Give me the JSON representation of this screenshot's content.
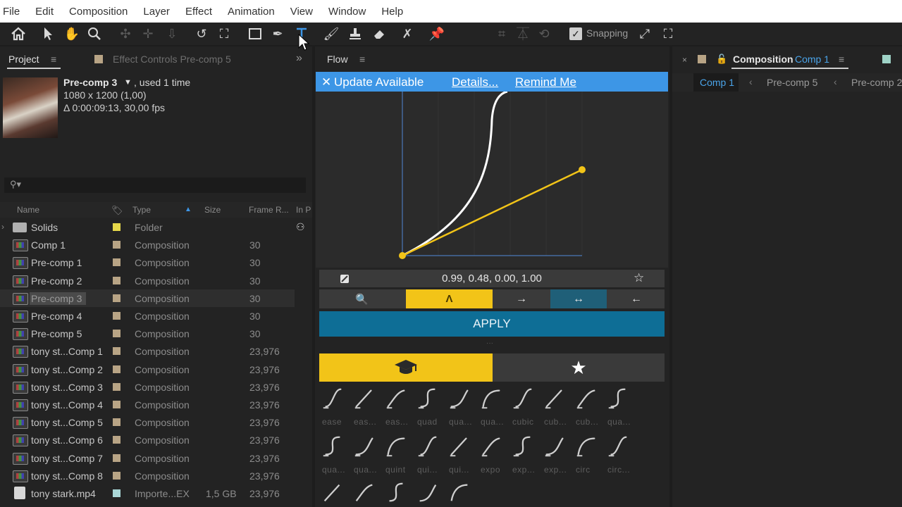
{
  "menu": [
    "File",
    "Edit",
    "Composition",
    "Layer",
    "Effect",
    "Animation",
    "View",
    "Window",
    "Help"
  ],
  "toolbar": {
    "snapping_label": "Snapping"
  },
  "project_panel": {
    "tab_label": "Project",
    "effect_controls_label": "Effect Controls Pre-comp 5",
    "selected_name": "Pre-comp 3",
    "used_info": ", used 1 time",
    "dimensions": "1080 x 1200 (1,00)",
    "duration": "Δ 0:00:09:13, 30,00 fps",
    "columns": [
      "Name",
      "Type",
      "Size",
      "Frame R...",
      "In P"
    ],
    "rows": [
      {
        "name": "Solids",
        "type": "Folder",
        "size": "",
        "fps": "",
        "kind": "folder"
      },
      {
        "name": "Comp 1",
        "type": "Composition",
        "size": "",
        "fps": "30",
        "kind": "comp"
      },
      {
        "name": "Pre-comp 1",
        "type": "Composition",
        "size": "",
        "fps": "30",
        "kind": "comp"
      },
      {
        "name": "Pre-comp 2",
        "type": "Composition",
        "size": "",
        "fps": "30",
        "kind": "comp"
      },
      {
        "name": "Pre-comp 3",
        "type": "Composition",
        "size": "",
        "fps": "30",
        "kind": "comp",
        "selected": true
      },
      {
        "name": "Pre-comp 4",
        "type": "Composition",
        "size": "",
        "fps": "30",
        "kind": "comp"
      },
      {
        "name": "Pre-comp 5",
        "type": "Composition",
        "size": "",
        "fps": "30",
        "kind": "comp"
      },
      {
        "name": "tony st...Comp 1",
        "type": "Composition",
        "size": "",
        "fps": "23,976",
        "kind": "comp"
      },
      {
        "name": "tony st...Comp 2",
        "type": "Composition",
        "size": "",
        "fps": "23,976",
        "kind": "comp"
      },
      {
        "name": "tony st...Comp 3",
        "type": "Composition",
        "size": "",
        "fps": "23,976",
        "kind": "comp"
      },
      {
        "name": "tony st...Comp 4",
        "type": "Composition",
        "size": "",
        "fps": "23,976",
        "kind": "comp"
      },
      {
        "name": "tony st...Comp 5",
        "type": "Composition",
        "size": "",
        "fps": "23,976",
        "kind": "comp"
      },
      {
        "name": "tony st...Comp 6",
        "type": "Composition",
        "size": "",
        "fps": "23,976",
        "kind": "comp"
      },
      {
        "name": "tony st...Comp 7",
        "type": "Composition",
        "size": "",
        "fps": "23,976",
        "kind": "comp"
      },
      {
        "name": "tony st...Comp 8",
        "type": "Composition",
        "size": "",
        "fps": "23,976",
        "kind": "comp"
      },
      {
        "name": "tony stark.mp4",
        "type": "Importe...EX",
        "size": "1,5 GB",
        "fps": "23,976",
        "kind": "footage"
      }
    ]
  },
  "flow_panel": {
    "tab_label": "Flow",
    "update_text": "Update Available",
    "details_link": "Details...",
    "remind_link": "Remind Me",
    "curve_values": "0.99, 0.48, 0.00, 1.00",
    "apply_label": "APPLY",
    "presets_row1": [
      "ease",
      "eas...",
      "eas...",
      "quad",
      "qua...",
      "qua...",
      "cubic",
      "cub...",
      "cub...",
      "qua..."
    ],
    "presets_row2": [
      "qua...",
      "qua...",
      "quint",
      "qui...",
      "qui...",
      "expo",
      "exp...",
      "exp...",
      "circ",
      "circ..."
    ]
  },
  "composition_panel": {
    "label": "Composition",
    "active_comp": "Comp 1",
    "breadcrumbs": [
      "Comp 1",
      "Pre-comp 5",
      "Pre-comp 2"
    ]
  },
  "colors": {
    "accent_yellow": "#f2c418",
    "flow_blue": "#3d96e6",
    "apply_blue": "#0e6e96",
    "comp_blue": "#4aa3e8"
  }
}
